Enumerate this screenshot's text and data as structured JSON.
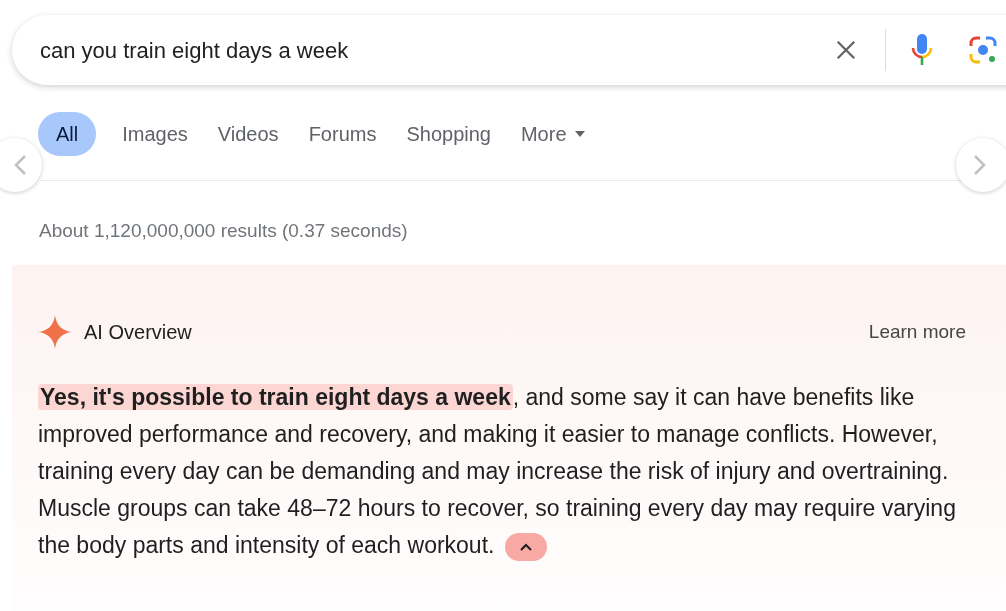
{
  "search": {
    "value": "can you train eight days a week"
  },
  "tabs": [
    {
      "label": "All",
      "selected": true,
      "kind": "tab"
    },
    {
      "label": "Images",
      "selected": false,
      "kind": "tab"
    },
    {
      "label": "Videos",
      "selected": false,
      "kind": "tab"
    },
    {
      "label": "Forums",
      "selected": false,
      "kind": "tab"
    },
    {
      "label": "Shopping",
      "selected": false,
      "kind": "tab"
    },
    {
      "label": "More",
      "selected": false,
      "kind": "menu"
    }
  ],
  "result_stats": "About 1,120,000,000 results (0.37 seconds)",
  "ai_overview": {
    "title": "AI Overview",
    "learn_more": "Learn more",
    "text": "**Yes, it's possible to train eight days a week**, and some say it can have benefits like improved performance and recovery, and making it easier to manage conflicts. However, training every day can be demanding and may increase the risk of injury and overtraining. Muscle groups can take 48–72 hours to recover, so training every day may require varying the body parts and intensity of each workout.",
    "expanded": true
  }
}
